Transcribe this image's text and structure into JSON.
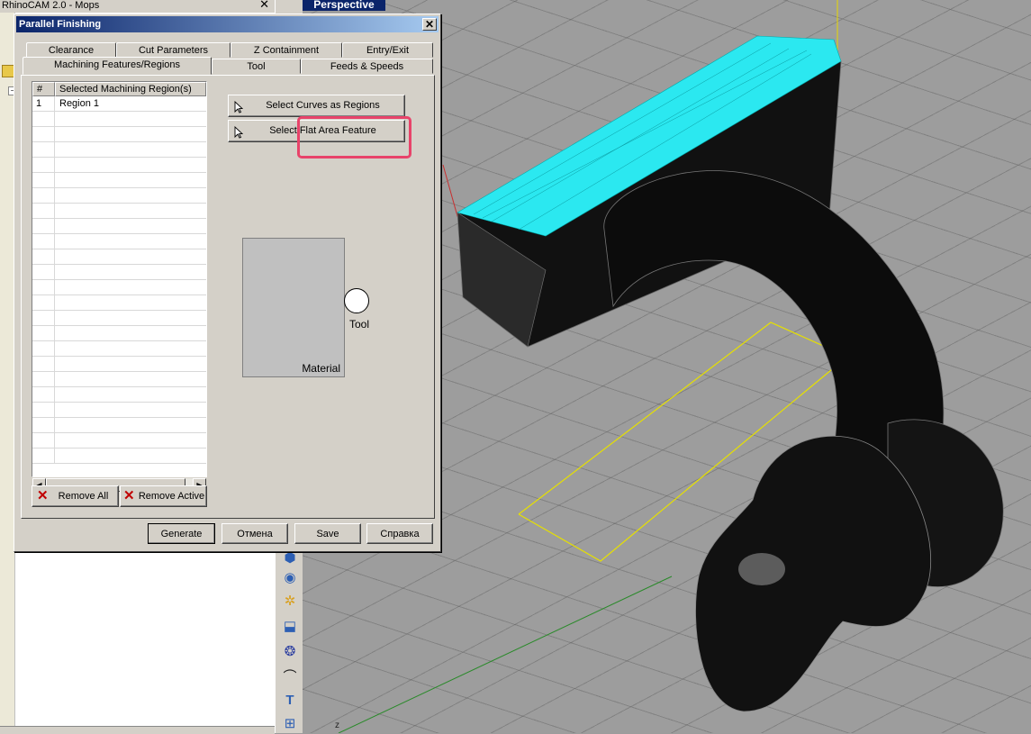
{
  "left_panel": {
    "title": "RhinoCAM 2.0 - Mops",
    "close": "✕",
    "tree_toggle": "−"
  },
  "viewport": {
    "title": "Perspective",
    "axis_label": "z"
  },
  "dialog": {
    "title": "Parallel Finishing",
    "close": "✕",
    "tabs_row1": [
      "Clearance",
      "Cut Parameters",
      "Z Containment",
      "Entry/Exit"
    ],
    "tabs_row2": [
      "Machining Features/Regions",
      "Tool",
      "Feeds & Speeds"
    ],
    "active_tab": "Machining Features/Regions",
    "region_list": {
      "col_num": "#",
      "col_region": "Selected Machining Region(s)",
      "rows": [
        {
          "num": "1",
          "name": "Region 1"
        }
      ]
    },
    "select_curves_btn": "Select Curves as Regions",
    "select_flat_btn": "Select Flat Area Feature",
    "material_label": "Material",
    "tool_label": "Tool",
    "remove_all_btn": "Remove All",
    "remove_active_btn": "Remove Active",
    "footer": {
      "generate": "Generate",
      "cancel": "Отмена",
      "save": "Save",
      "help": "Справка"
    }
  },
  "colors": {
    "highlight": "#e8436a",
    "toolpath": "#2be8f0",
    "titlebar": "#0a246a"
  }
}
